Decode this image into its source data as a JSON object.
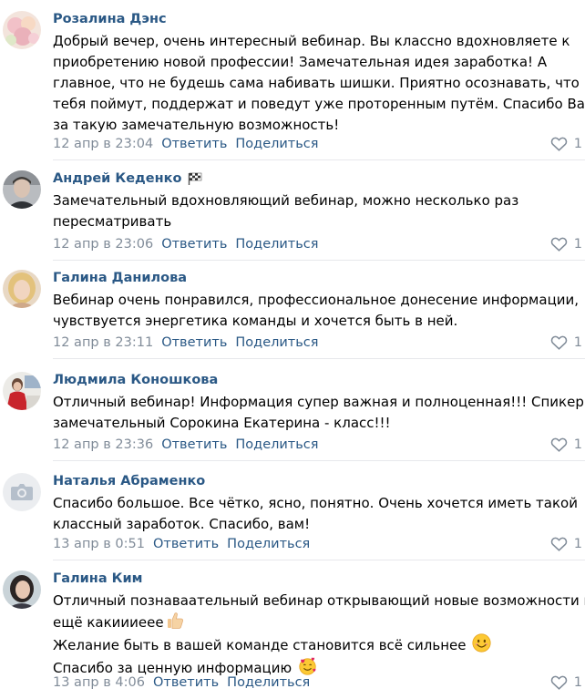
{
  "accent_color": "#2a5885",
  "meta_color": "#818c99",
  "comments": [
    {
      "author": "Розалина Дэнс",
      "lines": [
        "Добрый вечер, очень интересный вебинар. Вы классно вдохновляете к",
        "приобретению новой профессии! Замечательная идея заработка! А",
        "главное, что не будешь сама набивать шишки. Приятно осознавать, что",
        "тебя поймут, поддержат и поведут уже проторенным путём. Спасибо Вам",
        "за такую замечательную возможность!"
      ],
      "date": "12 апр в 23:04",
      "reply": "Ответить",
      "share": "Поделиться",
      "likes": "1",
      "avatar_icon": "flowers-photo-avatar"
    },
    {
      "author": "Андрей Кеденко",
      "lines": [
        "Замечательный вдохновляющий вебинар, можно несколько раз",
        "пересматривать"
      ],
      "date": "12 апр в 23:06",
      "reply": "Ответить",
      "share": "Поделиться",
      "likes": "1",
      "avatar_icon": "man-photo-avatar",
      "badge_icon": "checkered-flag-icon"
    },
    {
      "author": "Галина Данилова",
      "lines": [
        "Вебинар очень понравился, профессиональное донесение информации,",
        "чувствуется энергетика команды и хочется быть в ней."
      ],
      "date": "12 апр в 23:11",
      "reply": "Ответить",
      "share": "Поделиться",
      "likes": "1",
      "avatar_icon": "woman-photo-avatar"
    },
    {
      "author": "Людмила Коношкова",
      "lines": [
        "Отличный вебинар! Информация супер важная и полноценная!!! Спикер",
        "замечательный Сорокина Екатерина - класс!!!"
      ],
      "date": "12 апр в 23:36",
      "reply": "Ответить",
      "share": "Поделиться",
      "likes": "1",
      "avatar_icon": "woman-red-photo-avatar"
    },
    {
      "author": "Наталья Абраменко",
      "lines": [
        "Спасибо большое. Все чётко, ясно, понятно. Очень хочется иметь такой",
        "классный заработок. Спасибо, вам!"
      ],
      "date": "13 апр в 0:51",
      "reply": "Ответить",
      "share": "Поделиться",
      "likes": "1",
      "avatar_icon": "camera-placeholder-icon"
    },
    {
      "author": "Галина Ким",
      "lines": [
        "Отличный познаваательный вебинар открывающий новые возможности и",
        "ещё какиииеее",
        "Желание быть в вашей команде становится всё сильнее",
        "Спасибо за ценную информацию"
      ],
      "line_emojis": [
        "",
        "thumbs-up-emoji",
        "smiling-face-emoji",
        "smiling-face-with-hearts-emoji"
      ],
      "date": "13 апр в 4:06",
      "reply": "Ответить",
      "share": "Поделиться",
      "likes": "1",
      "avatar_icon": "woman-dark-photo-avatar"
    }
  ]
}
